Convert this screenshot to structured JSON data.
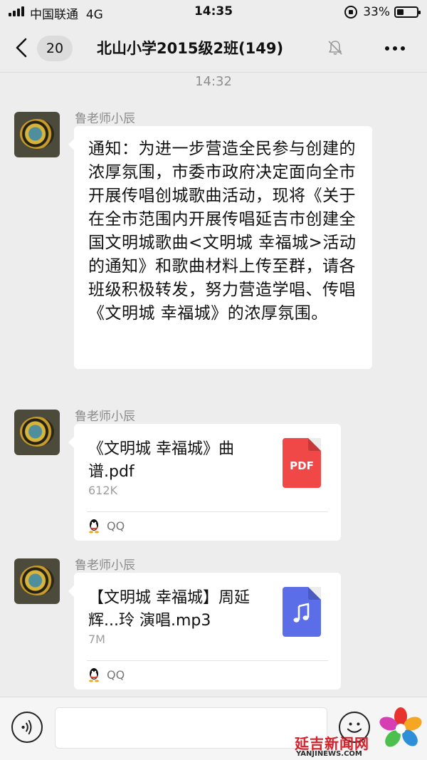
{
  "status_bar": {
    "carrier": "中国联通",
    "network": "4G",
    "time": "14:35",
    "battery_percent": "33%",
    "battery_level": 0.33
  },
  "nav": {
    "unread_count": "20",
    "title": "北山小学2015级2班(149)"
  },
  "time_divider": "14:32",
  "messages": [
    {
      "sender": "鲁老师小辰",
      "type": "text",
      "text": "通知：为进一步营造全民参与创建的浓厚氛围，市委市政府决定面向全市开展传唱创城歌曲活动，现将《关于在全市范围内开展传唱延吉市创建全国文明城歌曲<文明城  幸福城>活动的通知》和歌曲材料上传至群，请各班级积极转发，努力营造学唱、传唱《文明城 幸福城》的浓厚氛围。"
    },
    {
      "sender": "鲁老师小辰",
      "type": "file",
      "file_name": "《文明城  幸福城》曲谱.pdf",
      "file_size": "612K",
      "file_icon": "pdf-icon",
      "file_icon_label": "PDF",
      "file_icon_color": "#f04747",
      "source": "QQ"
    },
    {
      "sender": "鲁老师小辰",
      "type": "file",
      "file_name": "【文明城 幸福城】周延辉...玲 演唱.mp3",
      "file_size": "7M",
      "file_icon": "music-icon",
      "file_icon_color": "#5b6ee8",
      "source": "QQ"
    }
  ],
  "watermark": {
    "title": "延吉新闻网",
    "url": "YANJINEWS.COM"
  },
  "colors": {
    "background": "#ededed",
    "bubble": "#ffffff",
    "pdf": "#f04747",
    "music": "#5b6ee8",
    "watermark_red": "#d8202a"
  }
}
